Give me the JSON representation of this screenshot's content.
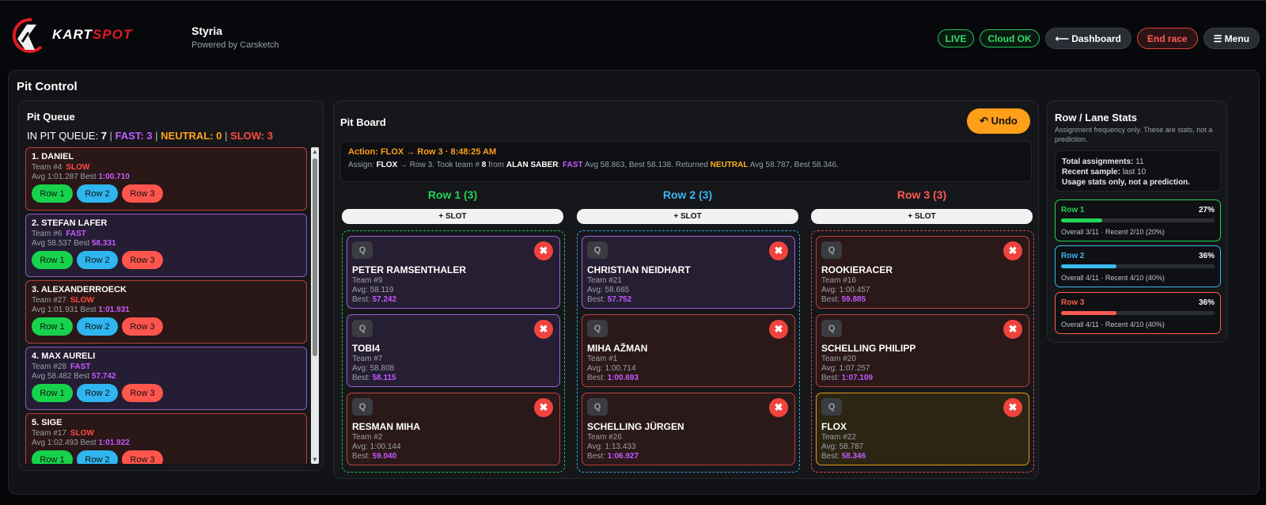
{
  "header": {
    "logo_text": "KARTSPOT",
    "venue": "Styria",
    "powered_by": "Powered by Carsketch",
    "live_label": "LIVE",
    "cloud_label": "Cloud OK",
    "dashboard_label": "⟵ Dashboard",
    "end_race_label": "End race",
    "menu_label": "☰ Menu"
  },
  "main_title": "Pit Control",
  "queue": {
    "title": "Pit Queue",
    "summary_label": "IN PIT QUEUE:",
    "total": "7",
    "fast_label": "FAST: 3",
    "neutral_label": "NEUTRAL: 0",
    "slow_label": "SLOW: 3",
    "items": [
      {
        "name": "1. DANIEL",
        "team": "Team #4",
        "tag": "SLOW",
        "avg": "Avg 1:01.287",
        "best_label": "Best",
        "best": "1:00.710",
        "kind": "slow"
      },
      {
        "name": "2. STEFAN LAFER",
        "team": "Team #6",
        "tag": "FAST",
        "avg": "Avg 58.537",
        "best_label": "Best",
        "best": "58.331",
        "kind": "fast"
      },
      {
        "name": "3. ALEXANDERROECK",
        "team": "Team #27",
        "tag": "SLOW",
        "avg": "Avg 1:01.931",
        "best_label": "Best",
        "best": "1:01.931",
        "kind": "slow"
      },
      {
        "name": "4. MAX AURELI",
        "team": "Team #28",
        "tag": "FAST",
        "avg": "Avg 58.482",
        "best_label": "Best",
        "best": "57.742",
        "kind": "fast"
      },
      {
        "name": "5. SIGE",
        "team": "Team #17",
        "tag": "SLOW",
        "avg": "Avg 1:02.493",
        "best_label": "Best",
        "best": "1:01.922",
        "kind": "slow"
      }
    ],
    "row_buttons": [
      "Row 1",
      "Row 2",
      "Row 3"
    ]
  },
  "board": {
    "title": "Pit Board",
    "undo_label": "↶ Undo",
    "action_line": "Action: FLOX → Row 3 · 8:48:25 AM",
    "assign_prefix": "Assign:",
    "assign_driver": "FLOX",
    "assign_mid": "→ Row 3. Took team #",
    "assign_team": "8",
    "assign_from": "from",
    "assign_from_driver": "ALAN SABER",
    "assign_fast": "FAST",
    "assign_stats": "Avg 58.863, Best 58.138. Returned",
    "assign_neutral": "NEUTRAL",
    "assign_stats2": "Avg 58.787, Best 58.346.",
    "slot_label": "+ SLOT",
    "q_label": "Q",
    "x_label": "✖",
    "rows": [
      {
        "header": "Row 1 (3)",
        "color": "#22d455",
        "cards": [
          {
            "name": "PETER RAMSENTHALER",
            "team": "Team #9",
            "avg": "Avg: 58.119",
            "best_label": "Best:",
            "best": "57.242",
            "kind": "fast"
          },
          {
            "name": "TOBI4",
            "team": "Team #7",
            "avg": "Avg: 58.808",
            "best_label": "Best:",
            "best": "58.115",
            "kind": "fast"
          },
          {
            "name": "RESMAN MIHA",
            "team": "Team #2",
            "avg": "Avg: 1:00.144",
            "best_label": "Best:",
            "best": "59.040",
            "kind": "slow"
          }
        ]
      },
      {
        "header": "Row 2 (3)",
        "color": "#3bb8ee",
        "cards": [
          {
            "name": "CHRISTIAN NEIDHART",
            "team": "Team #21",
            "avg": "Avg: 58.665",
            "best_label": "Best:",
            "best": "57.752",
            "kind": "fast"
          },
          {
            "name": "MIHA AŽMAN",
            "team": "Team #1",
            "avg": "Avg: 1:00.714",
            "best_label": "Best:",
            "best": "1:00.693",
            "kind": "slow"
          },
          {
            "name": "SCHELLING JÜRGEN",
            "team": "Team #26",
            "avg": "Avg: 1:13.433",
            "best_label": "Best:",
            "best": "1:06.927",
            "kind": "slow"
          }
        ]
      },
      {
        "header": "Row 3 (3)",
        "color": "#ff5a52",
        "cards": [
          {
            "name": "ROOKIERACER",
            "team": "Team #16",
            "avg": "Avg: 1:00.457",
            "best_label": "Best:",
            "best": "59.885",
            "kind": "slow"
          },
          {
            "name": "SCHELLING PHILIPP",
            "team": "Team #20",
            "avg": "Avg: 1:07.257",
            "best_label": "Best:",
            "best": "1:07.109",
            "kind": "slow"
          },
          {
            "name": "FLOX",
            "team": "Team #22",
            "avg": "Avg: 58.787",
            "best_label": "Best:",
            "best": "58.346",
            "kind": "neutral"
          }
        ]
      }
    ]
  },
  "stats": {
    "title": "Row / Lane Stats",
    "subtitle": "Assignment frequency only. These are stats, not a prediction.",
    "total_label": "Total assignments:",
    "total_value": "11",
    "recent_label": "Recent sample:",
    "recent_value": "last 10",
    "usage_note": "Usage stats only, not a prediction.",
    "lanes": [
      {
        "name": "Row 1",
        "pct": "27%",
        "fraction": 0.27,
        "detail": "Overall 3/11 · Recent 2/10 (20%)",
        "color": "#22d455"
      },
      {
        "name": "Row 2",
        "pct": "36%",
        "fraction": 0.36,
        "detail": "Overall 4/11 · Recent 4/10 (40%)",
        "color": "#3bb8ee"
      },
      {
        "name": "Row 3",
        "pct": "36%",
        "fraction": 0.36,
        "detail": "Overall 4/11 · Recent 4/10 (40%)",
        "color": "#ff5a52"
      }
    ]
  }
}
